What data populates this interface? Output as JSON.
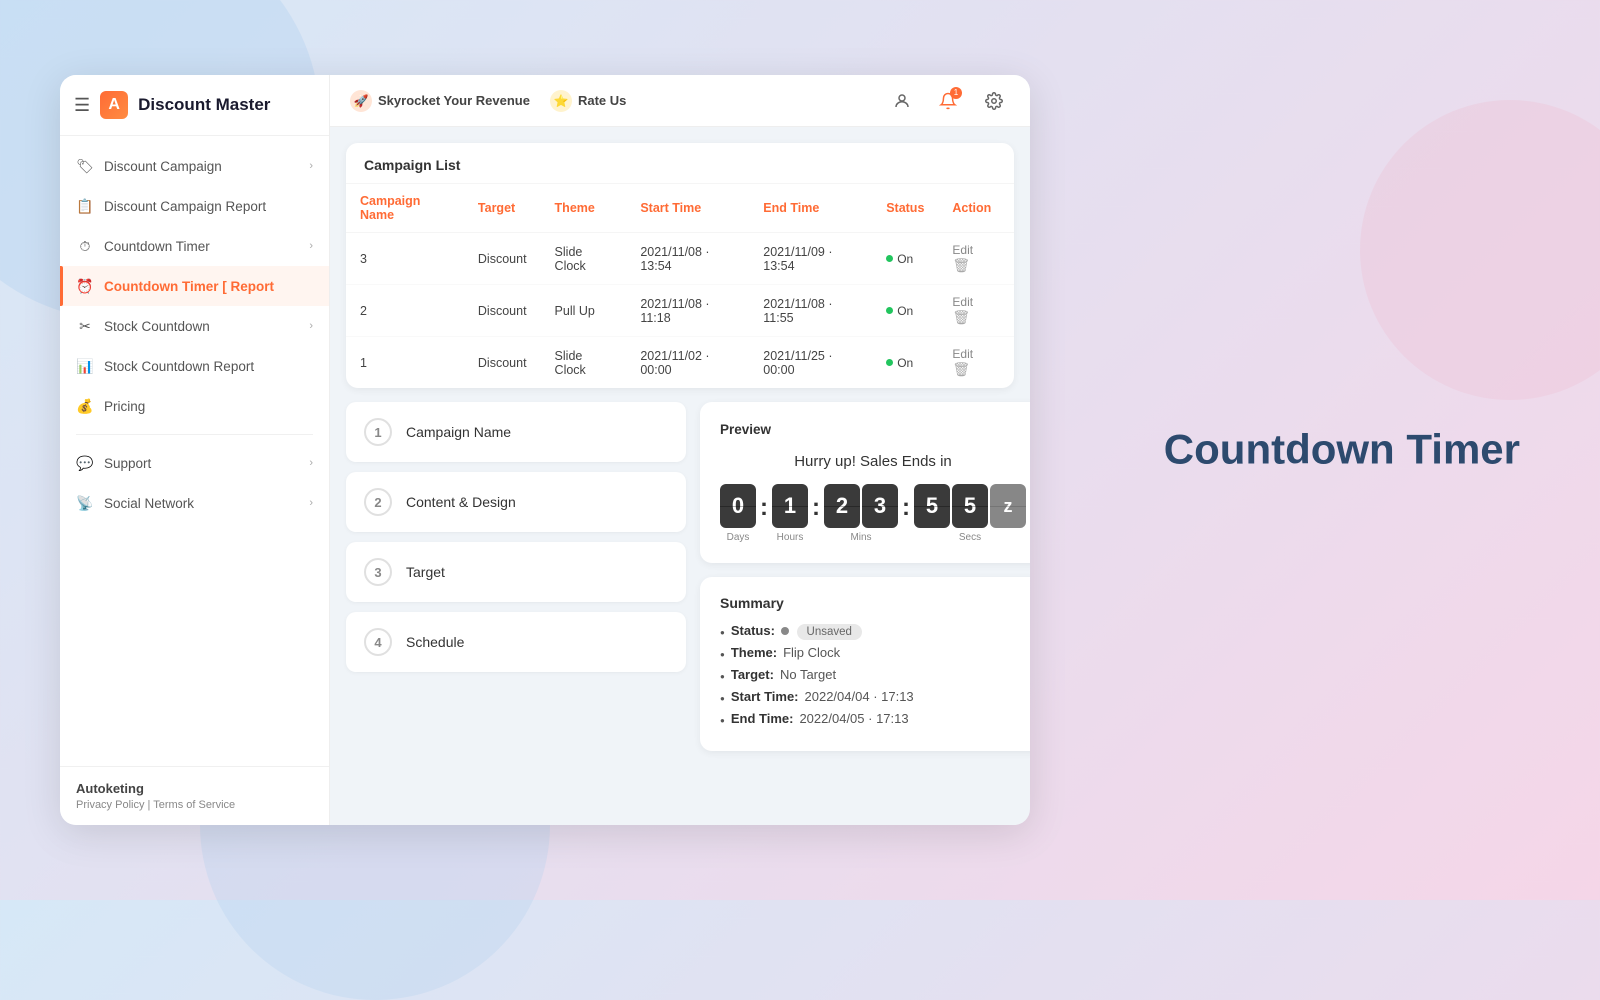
{
  "page": {
    "title_right": "Countdown Timer"
  },
  "sidebar": {
    "brand": "Discount Master",
    "logo_char": "A",
    "nav_items": [
      {
        "id": "discount-campaign",
        "label": "Discount Campaign",
        "icon": "🏷",
        "has_chevron": true,
        "active": false
      },
      {
        "id": "discount-campaign-report",
        "label": "Discount Campaign Report",
        "icon": "📋",
        "has_chevron": false,
        "active": false
      },
      {
        "id": "countdown-timer",
        "label": "Countdown Timer",
        "icon": "⏱",
        "has_chevron": true,
        "active": false
      },
      {
        "id": "countdown-timer-report",
        "label": "Countdown Timer [ Report",
        "icon": "🔴",
        "has_chevron": false,
        "active": true
      },
      {
        "id": "stock-countdown",
        "label": "Stock Countdown",
        "icon": "✂",
        "has_chevron": true,
        "active": false
      },
      {
        "id": "stock-countdown-report",
        "label": "Stock Countdown Report",
        "icon": "📊",
        "has_chevron": false,
        "active": false
      },
      {
        "id": "pricing",
        "label": "Pricing",
        "icon": "💰",
        "has_chevron": false,
        "active": false
      }
    ],
    "nav_items_bottom": [
      {
        "id": "support",
        "label": "Support",
        "icon": "💬",
        "has_chevron": true
      },
      {
        "id": "social-network",
        "label": "Social Network",
        "icon": "📡",
        "has_chevron": true
      }
    ],
    "footer": {
      "brand": "Autoketing",
      "privacy": "Privacy Policy",
      "separator": "|",
      "terms": "Terms of Service"
    }
  },
  "topbar": {
    "actions": [
      {
        "id": "skyrocket",
        "label": "Skyrocket Your Revenue",
        "icon": "🚀"
      },
      {
        "id": "rate-us",
        "label": "Rate Us",
        "icon": "⭐"
      }
    ],
    "notification_count": "1"
  },
  "campaign_list": {
    "title": "Campaign List",
    "columns": [
      "Campaign Name",
      "Target",
      "Theme",
      "Start Time",
      "End Time",
      "Status",
      "Action"
    ],
    "rows": [
      {
        "id": "3",
        "name": "3",
        "target": "Discount",
        "theme": "Slide Clock",
        "start": "2021/11/08 · 13:54",
        "end": "2021/11/09 · 13:54",
        "status": "On"
      },
      {
        "id": "2",
        "name": "2",
        "target": "Discount",
        "theme": "Pull Up",
        "start": "2021/11/08 · 11:18",
        "end": "2021/11/08 · 11:55",
        "status": "On"
      },
      {
        "id": "1",
        "name": "1",
        "target": "Discount",
        "theme": "Slide Clock",
        "start": "2021/11/02 · 00:00",
        "end": "2021/11/25 · 00:00",
        "status": "On"
      }
    ]
  },
  "steps": [
    {
      "number": "1",
      "label": "Campaign Name"
    },
    {
      "number": "2",
      "label": "Content & Design"
    },
    {
      "number": "3",
      "label": "Target"
    },
    {
      "number": "4",
      "label": "Schedule"
    }
  ],
  "preview": {
    "title": "Preview",
    "headline": "Hurry up! Sales Ends in",
    "digits": {
      "days": [
        "0"
      ],
      "hours": [
        "1"
      ],
      "mins": [
        "2",
        "3"
      ],
      "secs": [
        "5",
        "5"
      ],
      "secs_flip": "z"
    },
    "labels": {
      "days": "Days",
      "hours": "Hours",
      "mins": "Mins",
      "secs": "Secs"
    }
  },
  "summary": {
    "title": "Summary",
    "items": [
      {
        "key": "Status:",
        "value": "Unsaved",
        "is_badge": true
      },
      {
        "key": "Theme:",
        "value": "Flip Clock"
      },
      {
        "key": "Target:",
        "value": "No Target"
      },
      {
        "key": "Start Time:",
        "value": "2022/04/04 · 17:13"
      },
      {
        "key": "End Time:",
        "value": "2022/04/05 · 17:13"
      }
    ]
  }
}
